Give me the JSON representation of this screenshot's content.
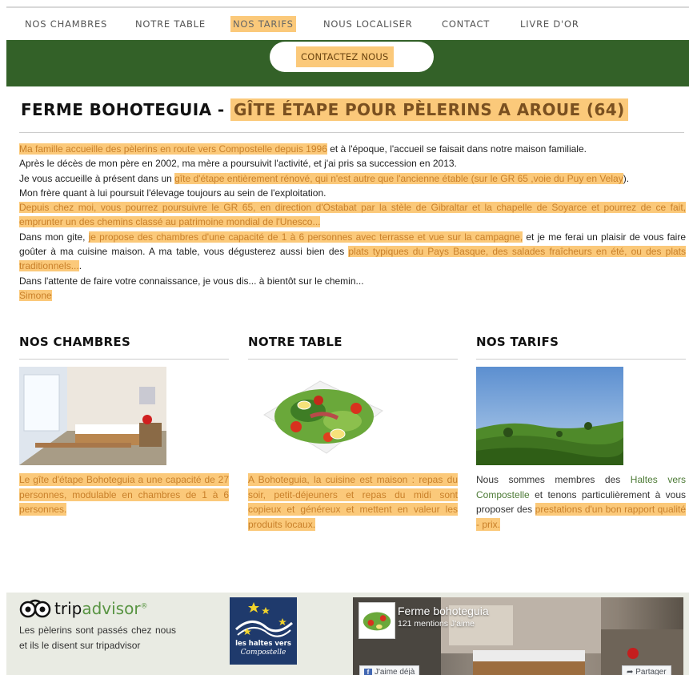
{
  "nav": {
    "items": [
      "NOS CHAMBRES",
      "NOTRE TABLE",
      "NOS TARIFS",
      "NOUS LOCALISER",
      "CONTACT",
      "LIVRE D'OR"
    ],
    "active": "NOS TARIFS"
  },
  "cta": {
    "label": "CONTACTEZ NOUS"
  },
  "title": {
    "main": "FERME BOHOTEGUIA - ",
    "highlight": "GÎTE ÉTAPE POUR PÈLERINS A AROUE (64)"
  },
  "intro": {
    "p1_hl": "Ma famille accueille des pèlerins en route vers Compostelle depuis 1996",
    "p1_rest": " et à l'époque, l'accueil se faisait dans notre maison familiale.",
    "p2": "Après le décès de mon père en 2002, ma mère a poursuivit l'activité, et j'ai pris sa succession en 2013.",
    "p3_a": "Je vous accueille à présent dans un ",
    "p3_hl1": "gîte d'étape entièrement rénové, qui n'est autre que l'ancienne étable (",
    "p3_hl2": "sur le GR 65 ,voie du Puy en Velay",
    "p3_b": ").",
    "p4": "Mon frère quant à lui poursuit l'élevage toujours au sein de l'exploitation.",
    "p5_hl": "Depuis chez moi, vous pourrez poursuivre le GR 65, en direction d'Ostabat par la stèle de Gibraltar et la chapelle de Soyarce et pourrez de ce fait, emprunter un des chemins classé au patrimoine mondial de l'Unesco...",
    "p6_a": "Dans mon gite, ",
    "p6_hl1": "je propose des chambres d'une capacité de 1 à 6 personnes avec terrasse et vue sur la campagne,",
    "p6_b": " et je me ferai un plaisir de vous faire goûter à ma cuisine maison. A ma table, vous dégusterez aussi bien des ",
    "p6_hl2": "plats typiques du Pays Basque, des salades fraîcheurs en été, ou des plats traditionnels...",
    "p6_c": ".",
    "p7": "Dans l'attente de faire votre connaissance, je vous dis... à bientôt sur le chemin...",
    "signature": "Simone"
  },
  "columns": [
    {
      "title": "NOS CHAMBRES",
      "desc": "Le gîte d'étape Bohoteguia a une capacité de 27 personnes, modulable en chambres de 1 à 6 personnes."
    },
    {
      "title": "NOTRE TABLE",
      "desc": "A Bohoteguia, la cuisine est maison : repas du soir, petit-déjeuners et repas du midi sont copieux et généreux et mettent en valeur les produits locaux."
    },
    {
      "title": "NOS TARIFS",
      "desc_a": "Nous sommes membres des ",
      "desc_link": "Haltes vers Compostelle",
      "desc_b": " et tenons particulièrement à vous proposer des ",
      "desc_hl": "prestations d'un bon rapport qualité - prix."
    }
  ],
  "footer": {
    "tripadvisor": {
      "brand_a": "trip",
      "brand_b": "advisor",
      "reg": "®",
      "text": "Les pèlerins sont passés chez nous et ils le disent sur tripadvisor"
    },
    "haltes": {
      "line1": "les haltes vers",
      "line2": "Compostelle"
    },
    "facebook": {
      "name": "Ferme bohoteguia",
      "likes": "121 mentions J'aime",
      "like_btn": "J'aime déjà",
      "share_btn": "Partager"
    }
  },
  "colors": {
    "green": "#336128",
    "highlight": "#fbc97a",
    "text_hl": "#c9802a"
  }
}
